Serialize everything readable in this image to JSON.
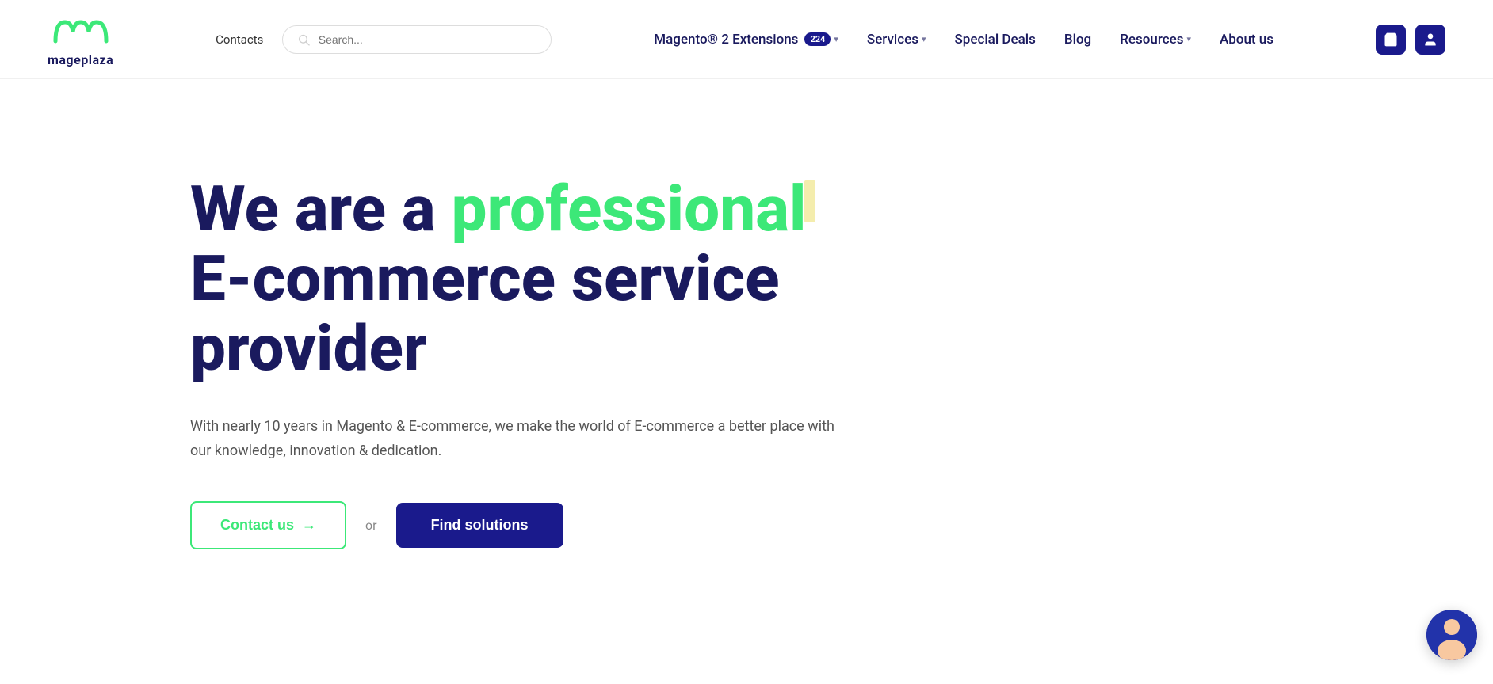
{
  "logo": {
    "text": "mageplaza",
    "aria": "Mageplaza logo"
  },
  "header": {
    "contacts_label": "Contacts",
    "search_placeholder": "Search...",
    "nav": [
      {
        "id": "magento-extensions",
        "label": "Magento® 2 Extensions",
        "badge": "224",
        "has_dropdown": true
      },
      {
        "id": "services",
        "label": "Services",
        "has_dropdown": true
      },
      {
        "id": "special-deals",
        "label": "Special Deals",
        "has_dropdown": false
      },
      {
        "id": "blog",
        "label": "Blog",
        "has_dropdown": false
      },
      {
        "id": "resources",
        "label": "Resources",
        "has_dropdown": true
      },
      {
        "id": "about-us",
        "label": "About us",
        "has_dropdown": false
      }
    ],
    "cart_icon": "cart",
    "user_icon": "user"
  },
  "hero": {
    "title_part1": "We are a ",
    "title_highlight": "professional",
    "title_part2": " E-commerce service provider",
    "subtitle": "With nearly 10 years in Magento & E-commerce, we make the world of E-commerce a better place with our knowledge, innovation & dedication.",
    "btn_contact": "Contact us",
    "btn_contact_arrow": "→",
    "or_text": "or",
    "btn_solutions": "Find solutions"
  },
  "colors": {
    "accent_green": "#3ce878",
    "accent_navy": "#1a1a8c",
    "text_dark": "#1a1a5e",
    "text_mid": "#555555",
    "highlight_yellow": "#f0e58a"
  }
}
